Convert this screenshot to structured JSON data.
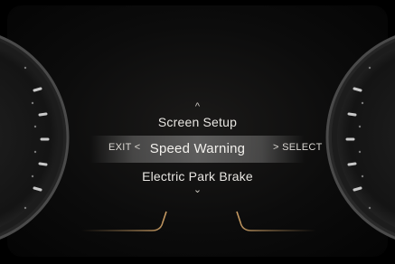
{
  "menu": {
    "up_indicator": "^",
    "items": [
      {
        "label": "Screen Setup"
      },
      {
        "label": "Speed Warning",
        "selected": true
      },
      {
        "label": "Electric Park Brake"
      }
    ],
    "down_indicator": "⌄",
    "exit_label": "EXIT <",
    "select_label": "> SELECT"
  },
  "colors": {
    "accent": "#b08a5a",
    "text": "#e8e6e2",
    "background": "#000000"
  }
}
